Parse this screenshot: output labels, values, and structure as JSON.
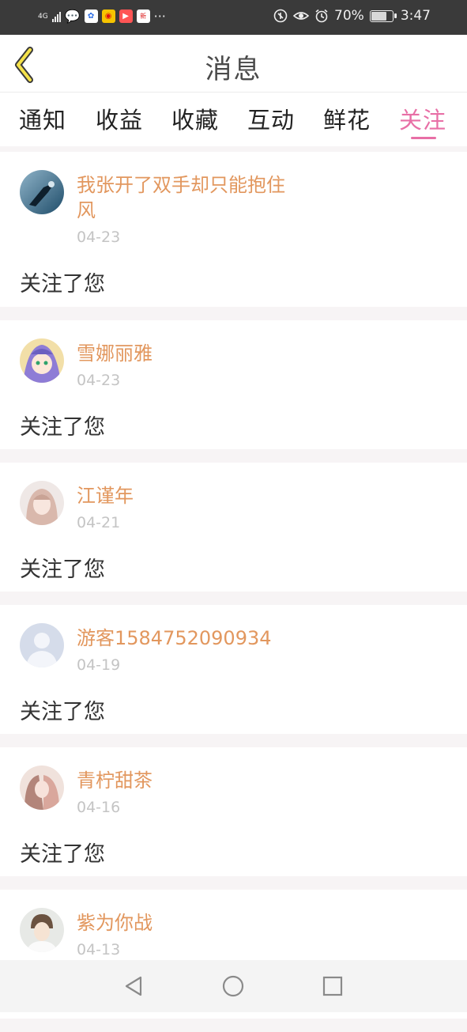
{
  "status_bar": {
    "network": "4G",
    "battery_percent": "70%",
    "battery_level": 0.7,
    "time": "3:47",
    "more": "···"
  },
  "header": {
    "title": "消息",
    "back_icon": "chevron-left-icon"
  },
  "tabs": [
    {
      "label": "通知",
      "active": false
    },
    {
      "label": "收益",
      "active": false
    },
    {
      "label": "收藏",
      "active": false
    },
    {
      "label": "互动",
      "active": false
    },
    {
      "label": "鲜花",
      "active": false
    },
    {
      "label": "关注",
      "active": true
    }
  ],
  "follows": [
    {
      "name": "我张开了双手却只能抱住风",
      "date": "04-23",
      "action": "关注了您"
    },
    {
      "name": "雪娜丽雅",
      "date": "04-23",
      "action": "关注了您"
    },
    {
      "name": "江谨年",
      "date": "04-21",
      "action": "关注了您"
    },
    {
      "name": "游客1584752090934",
      "date": "04-19",
      "action": "关注了您"
    },
    {
      "name": "青柠甜茶",
      "date": "04-16",
      "action": "关注了您"
    },
    {
      "name": "紫为你战",
      "date": "04-13",
      "action": ""
    }
  ],
  "colors": {
    "accent": "#e86fa6",
    "username": "#e2975e",
    "date": "#c4c4c4"
  },
  "nav": {
    "back_icon": "triangle-back-icon",
    "home_icon": "circle-home-icon",
    "recents_icon": "square-recents-icon"
  }
}
